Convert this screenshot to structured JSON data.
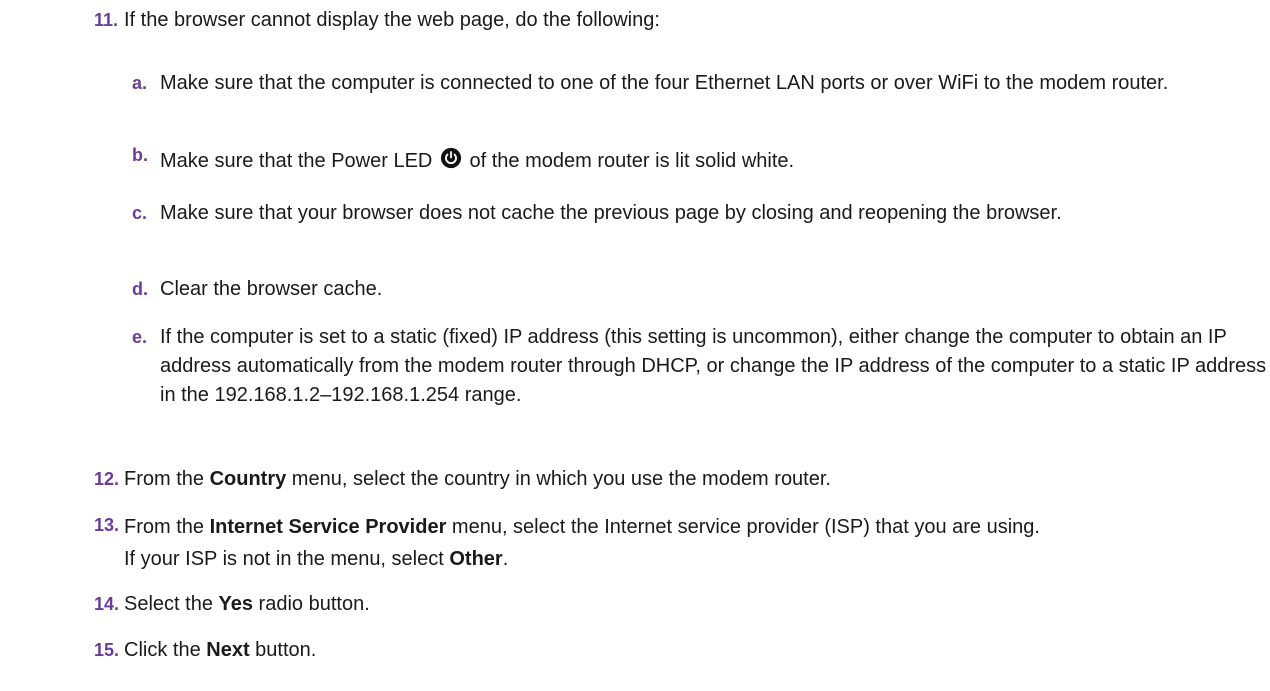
{
  "steps": {
    "s11": {
      "num": "11.",
      "text": "If the browser cannot display the web page, do the following:"
    },
    "s12": {
      "num": "12.",
      "pre": "From the ",
      "bold": "Country",
      "post": " menu, select the country in which you use the modem router."
    },
    "s13": {
      "num": "13.",
      "pre": "From the ",
      "bold": "Internet Service Provider",
      "post": " menu, select the Internet service provider (ISP) that you are using.",
      "line2_pre": "If your ISP is not in the menu, select ",
      "line2_bold": "Other",
      "line2_post": "."
    },
    "s14": {
      "num": "14.",
      "pre": "Select the ",
      "bold": "Yes",
      "post": " radio button."
    },
    "s15": {
      "num": "15.",
      "pre": "Click the ",
      "bold": "Next",
      "post": " button."
    }
  },
  "substeps": {
    "a": {
      "letter": "a.",
      "text": "Make sure that the computer is connected to one of the four Ethernet LAN ports or over WiFi to the modem router."
    },
    "b": {
      "letter": "b.",
      "pre": "Make sure that the Power LED ",
      "post": " of the modem router is lit solid white.",
      "icon": "power-icon"
    },
    "c": {
      "letter": "c.",
      "text": "Make sure that your browser does not cache the previous page by closing and reopening the browser."
    },
    "d": {
      "letter": "d.",
      "text": "Clear the browser cache."
    },
    "e": {
      "letter": "e.",
      "text": "If the computer is set to a static (fixed) IP address (this setting is uncommon), either change the computer to obtain an IP address automatically from the modem router through DHCP, or change the IP address of the computer to a static IP address in the 192.168.1.2–192.168.1.254 range."
    }
  },
  "colors": {
    "accent": "#6a3d9a",
    "text": "#1a1a1a"
  }
}
